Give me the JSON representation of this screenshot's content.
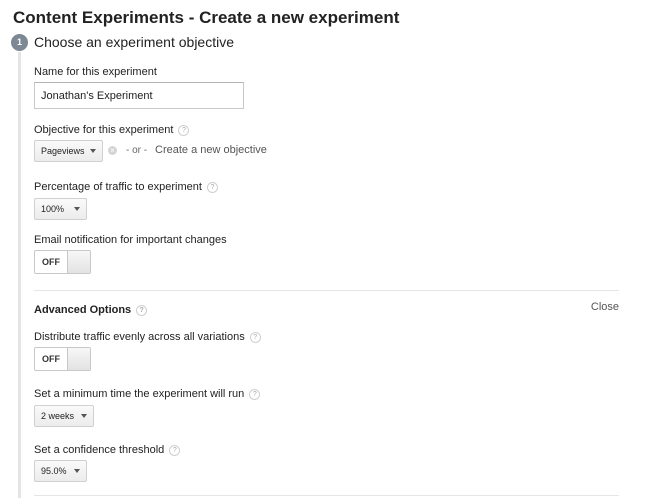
{
  "page_title": "Content Experiments - Create a new experiment",
  "step": {
    "number": "1",
    "title": "Choose an experiment objective"
  },
  "name_field": {
    "label": "Name for this experiment",
    "value": "Jonathan's Experiment"
  },
  "objective": {
    "label": "Objective for this experiment",
    "selected": "Pageviews",
    "or_text": "- or -",
    "create_link": "Create a new objective"
  },
  "traffic": {
    "label": "Percentage of traffic to experiment",
    "selected": "100%"
  },
  "email_notification": {
    "label": "Email notification for important changes",
    "state": "OFF"
  },
  "advanced": {
    "title": "Advanced Options",
    "close_label": "Close",
    "distribute": {
      "label": "Distribute traffic evenly across all variations",
      "state": "OFF"
    },
    "min_time": {
      "label": "Set a minimum time the experiment will run",
      "selected": "2 weeks"
    },
    "confidence": {
      "label": "Set a confidence threshold",
      "selected": "95.0%"
    }
  },
  "icons": {
    "help": "question-mark-circle",
    "clear": "x-circle",
    "dropdown": "caret-down"
  },
  "colors": {
    "step_badge": "#7d8895",
    "divider": "#e6e6e6"
  }
}
